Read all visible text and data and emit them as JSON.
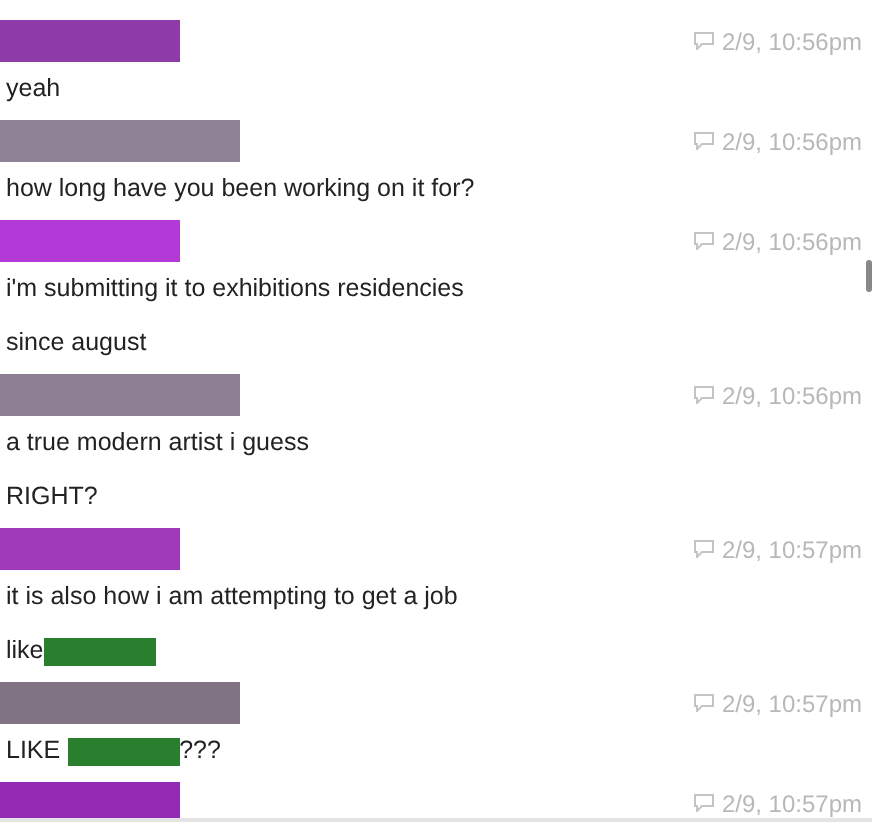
{
  "messages": [
    {
      "kind": "me",
      "color": "#8e3aa8",
      "time": "2/9, 10:56pm",
      "lines": [
        [
          {
            "kind": "text",
            "text": "yeah"
          }
        ]
      ]
    },
    {
      "kind": "them",
      "color": "#8e8394",
      "time": "2/9, 10:56pm",
      "lines": [
        [
          {
            "kind": "text",
            "text": "how long have you been working on it for?"
          }
        ]
      ]
    },
    {
      "kind": "me",
      "color": "#b43ad8",
      "time": "2/9, 10:56pm",
      "lines": [
        [
          {
            "kind": "text",
            "text": "i'm submitting it to exhibitions residencies"
          }
        ],
        [
          {
            "kind": "text",
            "text": "since august"
          }
        ]
      ]
    },
    {
      "kind": "them",
      "color": "#8e8092",
      "time": "2/9, 10:56pm",
      "lines": [
        [
          {
            "kind": "text",
            "text": "a true modern artist i guess"
          }
        ],
        [
          {
            "kind": "text",
            "text": "RIGHT?"
          }
        ]
      ]
    },
    {
      "kind": "me",
      "color": "#a03ab8",
      "time": "2/9, 10:57pm",
      "lines": [
        [
          {
            "kind": "text",
            "text": "it is also how i am attempting to get a job"
          }
        ],
        [
          {
            "kind": "text",
            "text": "like"
          },
          {
            "kind": "redaction",
            "color": "#2a7f2f"
          }
        ]
      ]
    },
    {
      "kind": "them",
      "color": "#807484",
      "time": "2/9, 10:57pm",
      "lines": [
        [
          {
            "kind": "text",
            "text": "LIKE "
          },
          {
            "kind": "redaction",
            "color": "#2a7f2f"
          },
          {
            "kind": "text",
            "text": "???"
          }
        ]
      ]
    },
    {
      "kind": "me",
      "color": "#942ab4",
      "time": "2/9, 10:57pm"
    }
  ]
}
